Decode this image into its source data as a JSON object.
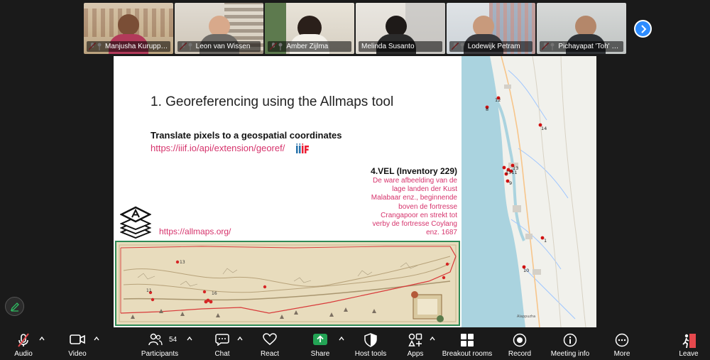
{
  "participants_gallery": [
    {
      "name": "Manjusha Kuruppa..."
    },
    {
      "name": "Leon van Wissen"
    },
    {
      "name": "Amber Zijlma"
    },
    {
      "name": "Melinda Susanto"
    },
    {
      "name": "Lodewijk Petram"
    },
    {
      "name": "Pichayapat 'Toh' Naisu..."
    }
  ],
  "slide": {
    "title": "1. Georeferencing using the Allmaps tool",
    "subtitle": "Translate pixels to a geospatial coordinates",
    "link1": "https://iiif.io/api/extension/georef/",
    "link2": "https://allmaps.org/",
    "vel_title": "4.VEL (Inventory 229)",
    "vel_lines": [
      "De ware afbeelding van de",
      "lage landen der Kust",
      "Malabaar enz., beginnende",
      "boven de fortresse",
      "Crangapoor en strekt tot",
      "verby de fortresse Coylang",
      "enz. 1687"
    ]
  },
  "map_labels": {
    "m12": "12",
    "m8": "8",
    "m14": "14",
    "m13": "13",
    "mgroup": "1511",
    "m9": "9",
    "m1": "1",
    "m10": "10",
    "place": "Alappuzha",
    "old_a": "13",
    "old_b": "11",
    "old_c": "16"
  },
  "toolbar": {
    "audio": "Audio",
    "video": "Video",
    "participants": "Participants",
    "participants_count": "54",
    "chat": "Chat",
    "react": "React",
    "share": "Share",
    "host_tools": "Host tools",
    "apps": "Apps",
    "breakout": "Breakout rooms",
    "record": "Record",
    "meeting_info": "Meeting info",
    "more": "More",
    "leave": "Leave"
  },
  "colors": {
    "accent_green": "#2fbf63",
    "share_green": "#23a455",
    "link_pink": "#d6336c",
    "mute_red": "#e5484d",
    "zoom_blue": "#2d8cff"
  }
}
